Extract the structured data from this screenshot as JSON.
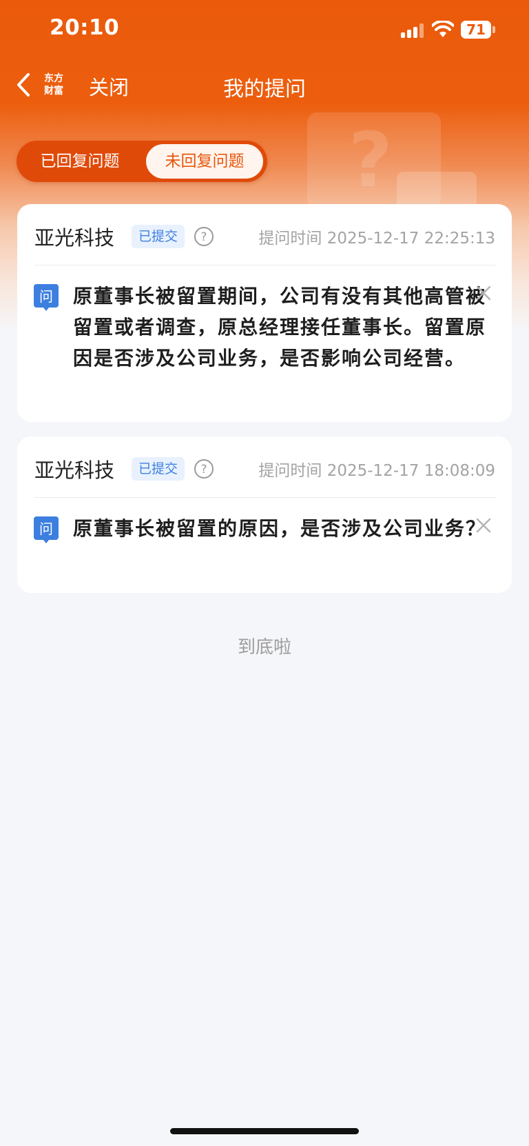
{
  "status_bar": {
    "time": "20:10",
    "battery": "71"
  },
  "nav": {
    "logo_line1": "东方",
    "logo_line2": "财富",
    "close_label": "关闭",
    "title": "我的提问"
  },
  "tabs": [
    {
      "label": "已回复问题",
      "selected": false
    },
    {
      "label": "未回复问题",
      "selected": true
    }
  ],
  "questions": [
    {
      "company": "亚光科技",
      "status": "已提交",
      "time_label": "提问时间 2025-12-17 22:25:13",
      "icon_label": "问",
      "text": "原董事长被留置期间，公司有没有其他高管被留置或者调查，原总经理接任董事长。留置原因是否涉及公司业务，是否影响公司经营。"
    },
    {
      "company": "亚光科技",
      "status": "已提交",
      "time_label": "提问时间 2025-12-17 18:08:09",
      "icon_label": "问",
      "text": "原董事长被留置的原因，是否涉及公司业务？"
    }
  ],
  "footer": {
    "end_text": "到底啦"
  },
  "colors": {
    "brand": "#ea5a0a",
    "badge_blue": "#3d7fe0",
    "background": "#f5f6f9"
  }
}
